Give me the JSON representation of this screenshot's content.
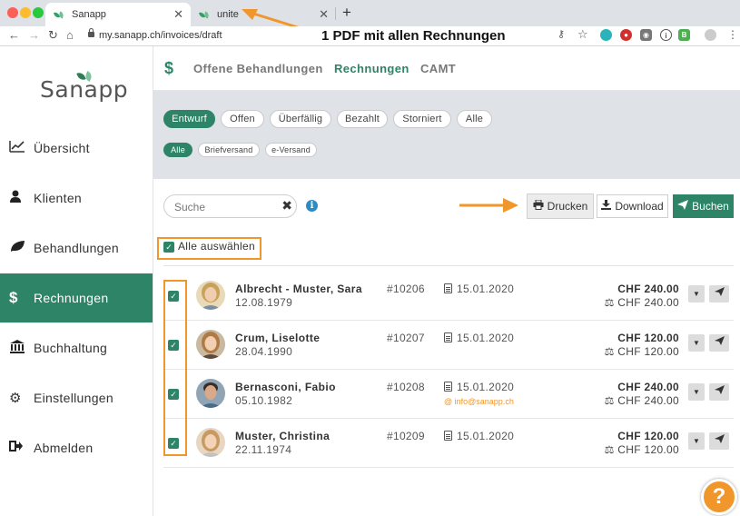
{
  "browser": {
    "tabs": [
      {
        "title": "Sanapp",
        "active": true
      },
      {
        "title": "unite",
        "active": false
      }
    ],
    "url": "my.sanapp.ch/invoices/draft",
    "annotation": "1 PDF mit allen Rechnungen"
  },
  "sidebar": {
    "logo": "Sanapp",
    "items": [
      {
        "label": "Übersicht",
        "icon": "chart-line-icon"
      },
      {
        "label": "Klienten",
        "icon": "user-icon"
      },
      {
        "label": "Behandlungen",
        "icon": "leaf-icon"
      },
      {
        "label": "Rechnungen",
        "icon": "dollar-icon",
        "active": true
      },
      {
        "label": "Buchhaltung",
        "icon": "bank-icon"
      },
      {
        "label": "Einstellungen",
        "icon": "gear-icon"
      },
      {
        "label": "Abmelden",
        "icon": "sign-out-icon"
      }
    ]
  },
  "topnav": {
    "icon": "$",
    "tabs": [
      "Offene Behandlungen",
      "Rechnungen",
      "CAMT"
    ],
    "active": "Rechnungen"
  },
  "filters": {
    "status": [
      "Entwurf",
      "Offen",
      "Überfällig",
      "Bezahlt",
      "Storniert",
      "Alle"
    ],
    "status_active": "Entwurf",
    "delivery": [
      "Alle",
      "Briefversand",
      "e-Versand"
    ],
    "delivery_active": "Alle"
  },
  "search": {
    "placeholder": "Suche"
  },
  "actions": {
    "print": "Drucken",
    "download": "Download",
    "book": "Buchen"
  },
  "select_all": "Alle auswählen",
  "invoices": [
    {
      "name": "Albrecht - Muster, Sara",
      "dob": "12.08.1979",
      "number": "#10206",
      "date": "15.01.2020",
      "email": "",
      "amount": "CHF 240.00",
      "amount_balance": "CHF 240.00",
      "checked": true
    },
    {
      "name": "Crum, Liselotte",
      "dob": "28.04.1990",
      "number": "#10207",
      "date": "15.01.2020",
      "email": "",
      "amount": "CHF 120.00",
      "amount_balance": "CHF 120.00",
      "checked": true
    },
    {
      "name": "Bernasconi, Fabio",
      "dob": "05.10.1982",
      "number": "#10208",
      "date": "15.01.2020",
      "email": "info@sanapp.ch",
      "amount": "CHF 240.00",
      "amount_balance": "CHF 240.00",
      "checked": true
    },
    {
      "name": "Muster, Christina",
      "dob": "22.11.1974",
      "number": "#10209",
      "date": "15.01.2020",
      "email": "",
      "amount": "CHF 120.00",
      "amount_balance": "CHF 120.00",
      "checked": true
    }
  ],
  "help": "?",
  "colors": {
    "brand": "#2d8466",
    "highlight": "#f0962a",
    "info": "#2b8cc4"
  }
}
